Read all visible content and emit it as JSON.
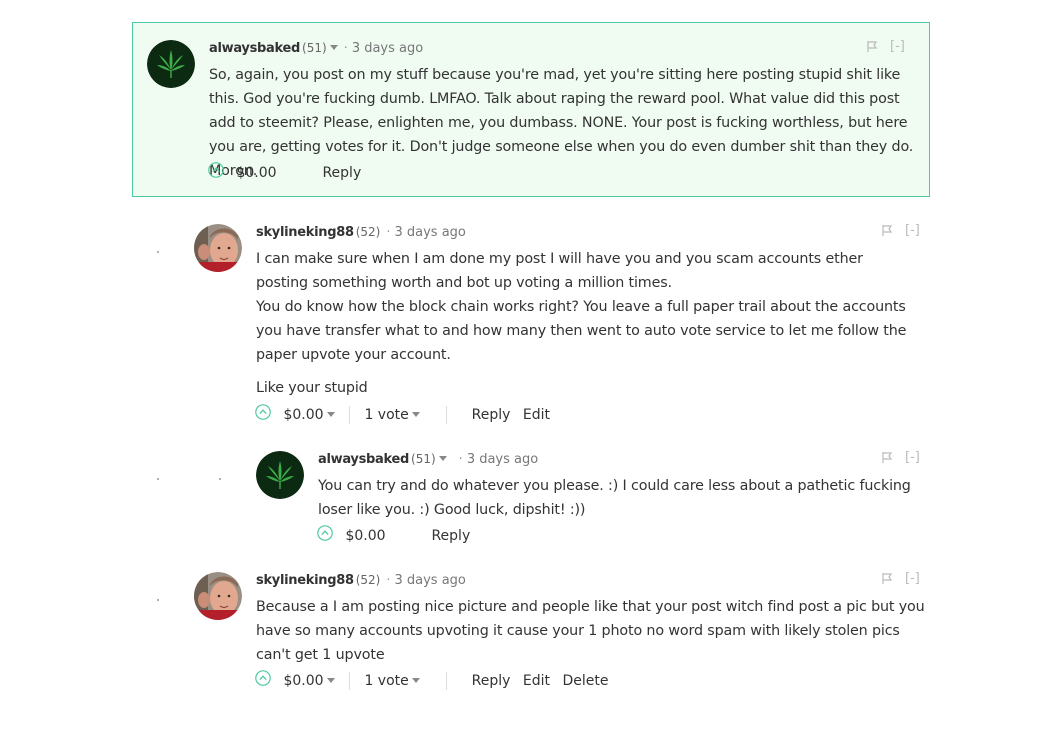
{
  "comments": [
    {
      "author": "alwaysbaked",
      "rep": "(51)",
      "time": "3 days ago",
      "body": [
        "So, again, you post on my stuff because you're mad, yet you're sitting here posting stupid shit like this. God you're fucking dumb. LMFAO. Talk about raping the reward pool. What value did this post add to steemit? Please, enlighten me, you dumbass. NONE. Your post is fucking worthless, but here you are, getting votes for it. Don't judge someone else when you do even dumber shit than they do. Moron."
      ],
      "payout": "$0.00",
      "reply": "Reply",
      "collapse": "[-]"
    },
    {
      "author": "skylineking88",
      "rep": "(52)",
      "time": "3 days ago",
      "body": [
        "I can make sure when I am done my post I will have you and you scam accounts ether posting something worth and bot up voting a million times.",
        "You do know how the block chain works right? You leave a full paper trail about the accounts you have transfer what to and how many then went to auto vote service to let me follow the paper upvote your account.",
        "Like your stupid"
      ],
      "payout": "$0.00",
      "votes": "1 vote",
      "reply": "Reply",
      "edit": "Edit",
      "collapse": "[-]"
    },
    {
      "author": "alwaysbaked",
      "rep": "(51)",
      "time": "3 days ago",
      "body": [
        "You can try and do whatever you please. :) I could care less about a pathetic fucking loser like you. :) Good luck, dipshit! :))"
      ],
      "payout": "$0.00",
      "reply": "Reply",
      "collapse": "[-]"
    },
    {
      "author": "skylineking88",
      "rep": "(52)",
      "time": "3 days ago",
      "body": [
        "Because a I am posting nice picture and people like that your post witch find post a pic but you have so many accounts upvoting it cause your 1 photo no word spam with likely stolen pics can't get 1 upvote"
      ],
      "payout": "$0.00",
      "votes": "1 vote",
      "reply": "Reply",
      "edit": "Edit",
      "delete": "Delete",
      "collapse": "[-]"
    }
  ],
  "colors": {
    "accent": "#4ecaa0",
    "highlight_bg": "#f0fbf2",
    "text": "#333333",
    "muted": "#777777"
  },
  "icons": {
    "flag": "flag-icon",
    "upvote": "upvote-icon",
    "caret": "chevron-down-icon",
    "weed": "cannabis-leaf-avatar",
    "face": "person-photo-avatar"
  }
}
